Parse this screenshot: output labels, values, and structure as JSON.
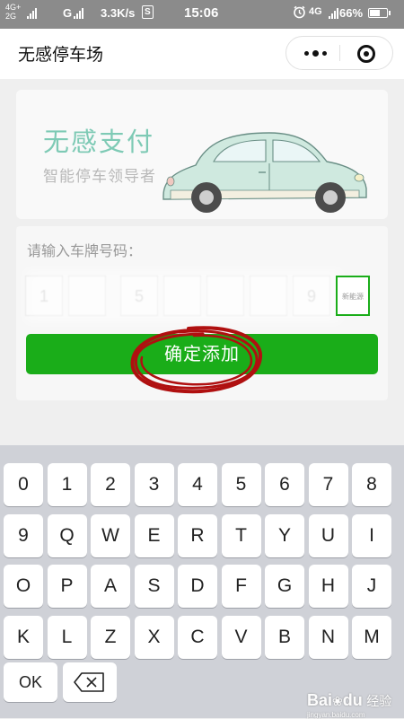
{
  "status_bar": {
    "network_top": "4G+",
    "network_bottom": "2G",
    "carrier_signal": "G",
    "speed": "3.3K/s",
    "app_badge": "S",
    "time": "15:06",
    "network_right": "4G",
    "battery": "66%",
    "battery_level": 0.66
  },
  "nav": {
    "title": "无感停车场"
  },
  "banner": {
    "title": "无感支付",
    "subtitle": "智能停车领导者"
  },
  "form": {
    "label": "请输入车牌号码：",
    "plate_chars": [
      "1",
      "",
      "5",
      "",
      "",
      "",
      "9"
    ],
    "new_energy_label": "新能源",
    "confirm_label": "确定添加"
  },
  "keyboard": {
    "rows": [
      [
        "0",
        "1",
        "2",
        "3",
        "4",
        "5",
        "6",
        "7",
        "8"
      ],
      [
        "9",
        "Q",
        "W",
        "E",
        "R",
        "T",
        "Y",
        "U",
        "I"
      ],
      [
        "O",
        "P",
        "A",
        "S",
        "D",
        "F",
        "G",
        "H",
        "J"
      ],
      [
        "K",
        "L",
        "Z",
        "X",
        "C",
        "V",
        "B",
        "N",
        "M"
      ]
    ],
    "ok_label": "OK"
  },
  "watermark": {
    "brand": "Bai",
    "brand2": "du",
    "cn": "经验",
    "url": "jingyan.baidu.com"
  },
  "colors": {
    "accent_green": "#1aad19",
    "banner_title": "#7ecab5",
    "annotation_red": "#b01010"
  }
}
